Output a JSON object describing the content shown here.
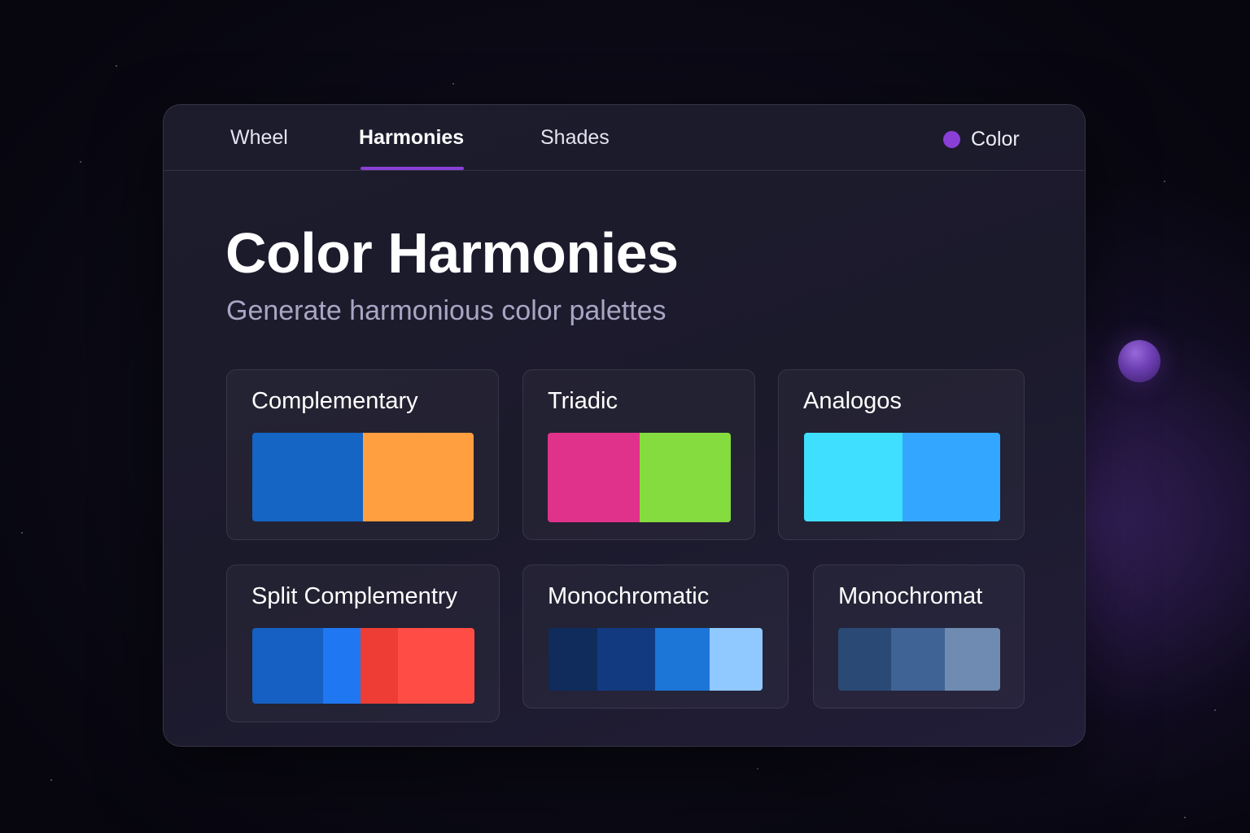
{
  "tabs": [
    {
      "label": "Wheel",
      "active": false
    },
    {
      "label": "Harmonies",
      "active": true
    },
    {
      "label": "Shades",
      "active": false
    }
  ],
  "color_picker": {
    "label": "Color",
    "dot_color": "#8a3fd6"
  },
  "header": {
    "title": "Color Harmonies",
    "subtitle": "Generate harmonious color palettes"
  },
  "accent_color": "#8a3fd6",
  "cards": [
    {
      "title": "Complementary",
      "swatches": [
        "#1565c4",
        "#ff9f40"
      ]
    },
    {
      "title": "Triadic",
      "swatches": [
        "#e0328a",
        "#84dc3e"
      ]
    },
    {
      "title": "Analogos",
      "swatches": [
        "#3fe0ff",
        "#33a6ff"
      ]
    },
    {
      "title": "Split Complementry",
      "swatches": [
        "#1560c2",
        "#2077f2",
        "#ee3d34",
        "#ff4d46"
      ]
    },
    {
      "title": "Monochromatic",
      "swatches": [
        "#0f2c5c",
        "#123a80",
        "#1c76d8",
        "#90c9ff"
      ]
    },
    {
      "title": "Monochromat",
      "swatches": [
        "#2a4a75",
        "#3f6395",
        "#6f8bb1"
      ]
    }
  ]
}
